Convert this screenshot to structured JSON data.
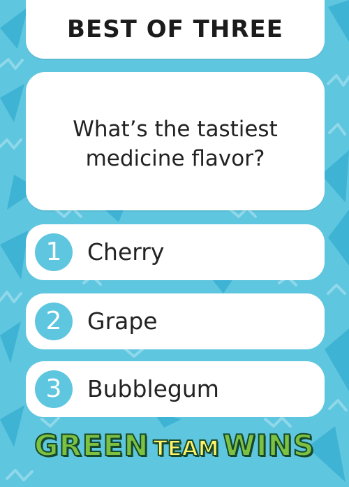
{
  "title": "BEST OF THREE",
  "question": "What’s the tastiest medicine flavor?",
  "answers": [
    {
      "number": "1",
      "label": "Cherry"
    },
    {
      "number": "2",
      "label": "Grape"
    },
    {
      "number": "3",
      "label": "Bubblegum"
    }
  ],
  "brand": {
    "word1": "GREEN",
    "word2": "TEAM",
    "word3": "WINS"
  },
  "colors": {
    "background": "#5fc6df",
    "pattern_triangle": "#3fb3d4",
    "pattern_squiggle": "#8fd8ea",
    "card": "#ffffff",
    "number_badge": "#5fc6df",
    "brand_green": "#7cc142",
    "brand_yellow": "#fef36a",
    "brand_outline": "#16492b"
  }
}
